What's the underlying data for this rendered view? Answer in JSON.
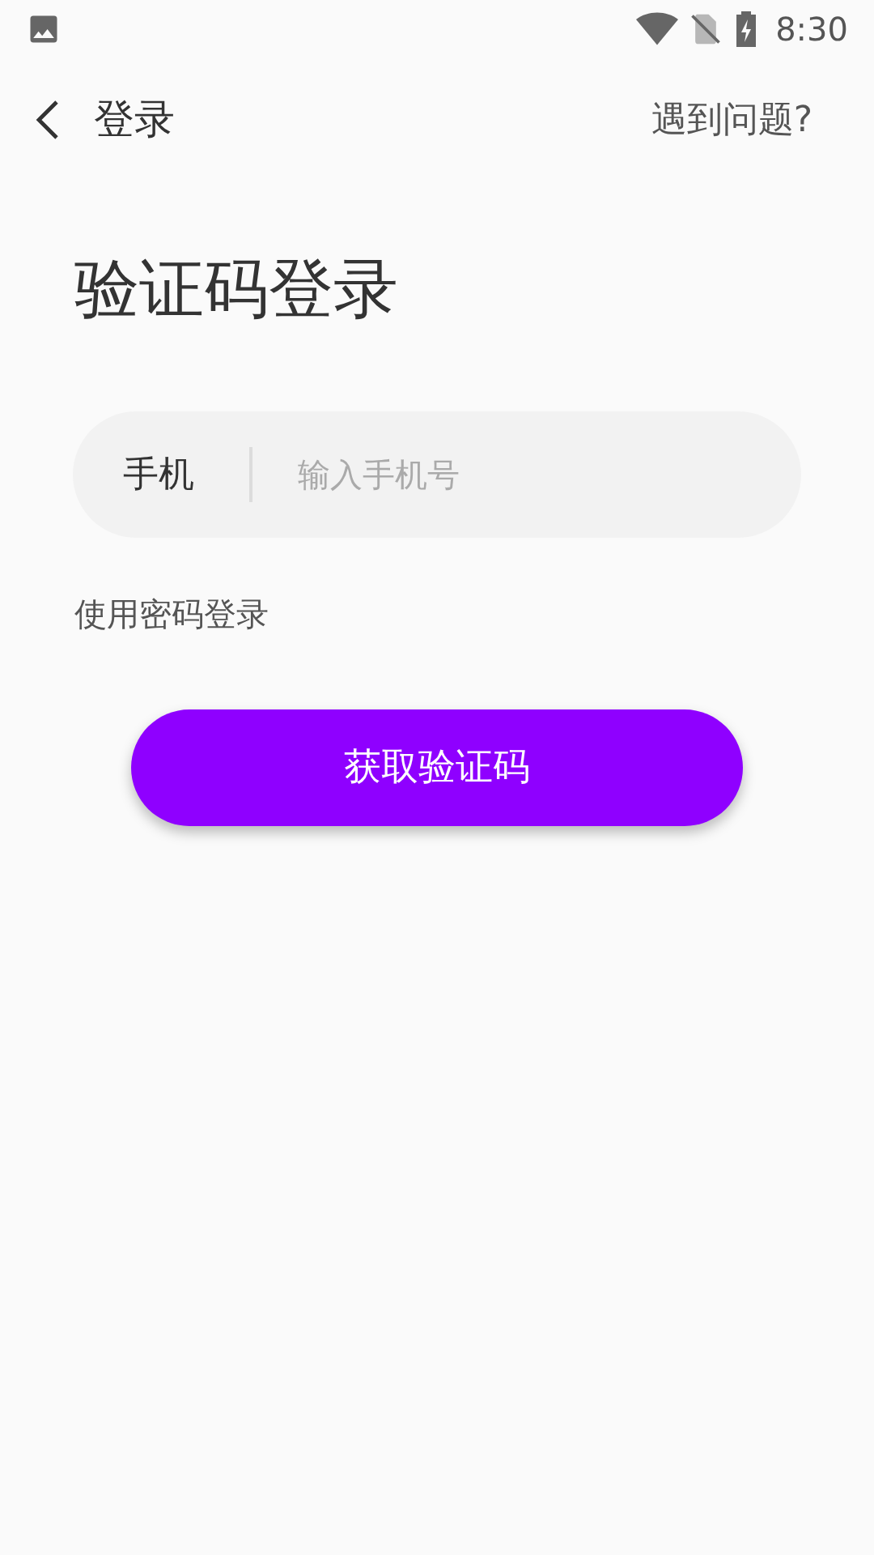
{
  "status_bar": {
    "time": "8:30"
  },
  "header": {
    "back": "登录",
    "help": "遇到问题?"
  },
  "title": "验证码登录",
  "phone_field": {
    "label": "手机",
    "placeholder": "输入手机号"
  },
  "password_login_link": "使用密码登录",
  "submit_button": "获取验证码"
}
